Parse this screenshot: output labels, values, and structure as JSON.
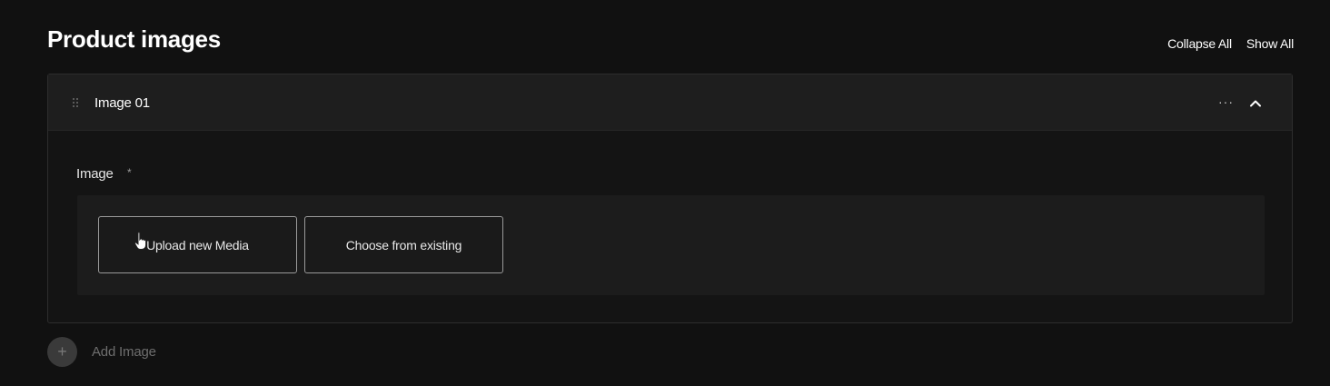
{
  "section": {
    "title": "Product images",
    "collapse_all": "Collapse All",
    "show_all": "Show All"
  },
  "panel": {
    "title": "Image 01",
    "more_icon": "more-horizontal-icon",
    "chevron_icon": "chevron-up-icon",
    "field_label": "Image",
    "required_mark": "*",
    "upload_button": "Upload new Media",
    "existing_button": "Choose from existing"
  },
  "add": {
    "icon": "plus-icon",
    "label": "Add Image"
  },
  "colors": {
    "background": "#111111",
    "panel_header": "#1e1e1e",
    "upload_area": "#1c1c1c",
    "button_border": "#9a9a9a"
  }
}
